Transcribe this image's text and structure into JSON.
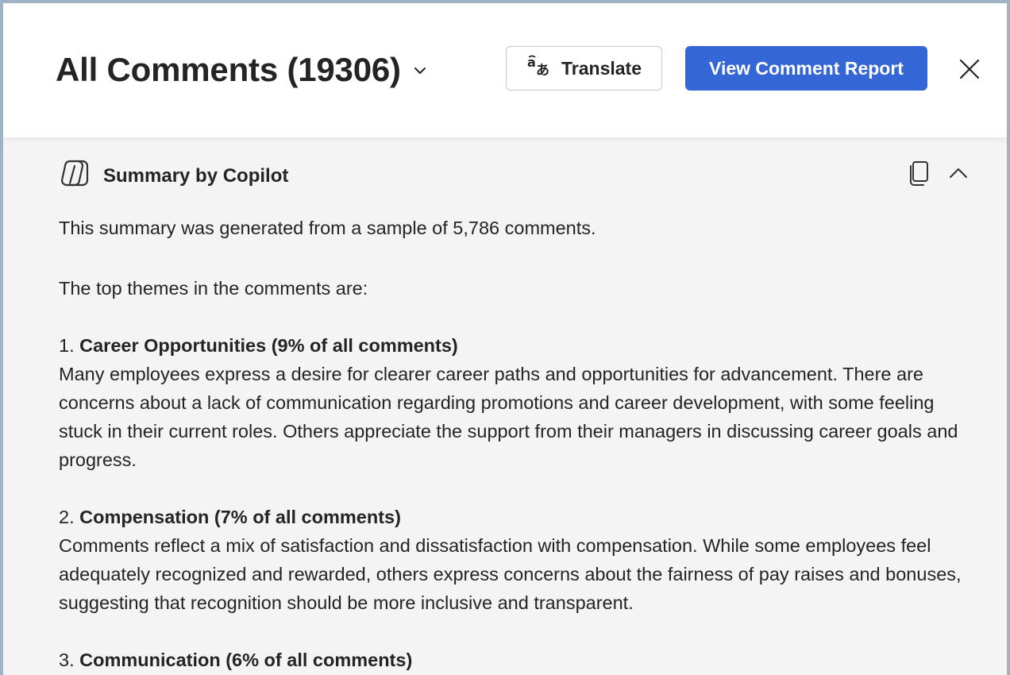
{
  "header": {
    "title": "All Comments (19306)",
    "translate_label": "Translate",
    "report_label": "View Comment Report"
  },
  "summary": {
    "title": "Summary by Copilot",
    "intro": "This summary was generated from a sample of 5,786 comments.",
    "top_themes_label": "The top themes in the comments are:",
    "themes": [
      {
        "number": "1.",
        "title": "Career Opportunities (9% of all comments)",
        "text": "Many employees express a desire for clearer career paths and opportunities for advancement. There are concerns about a lack of communication regarding promotions and career development, with some feeling stuck in their current roles. Others appreciate the support from their managers in discussing career goals and progress."
      },
      {
        "number": "2.",
        "title": "Compensation (7% of all comments)",
        "text": "Comments reflect a mix of satisfaction and dissatisfaction with compensation. While some employees feel adequately recognized and rewarded, others express concerns about the fairness of pay raises and bonuses, suggesting that recognition should be more inclusive and transparent."
      },
      {
        "number": "3.",
        "title": "Communication (6% of all comments)",
        "text": ""
      }
    ]
  },
  "colors": {
    "primary": "#3466d6",
    "panel_bg": "#f4f4f4",
    "frame_border": "#9fb3c4"
  },
  "icons": [
    "chevron-down-icon",
    "translate-icon",
    "close-icon",
    "copilot-icon",
    "copy-icon",
    "chevron-up-icon"
  ]
}
